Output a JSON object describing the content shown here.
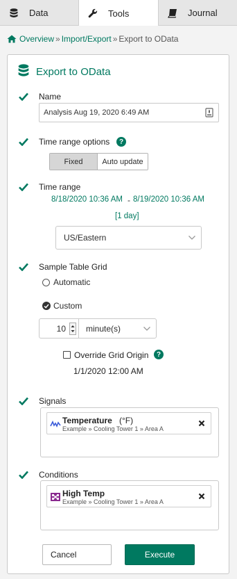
{
  "tabs": [
    {
      "label": "Data",
      "icon": "database-icon"
    },
    {
      "label": "Tools",
      "icon": "wrench-icon"
    },
    {
      "label": "Journal",
      "icon": "book-icon"
    }
  ],
  "breadcrumb": {
    "home": "Overview",
    "sep": "»",
    "import_export": "Import/Export",
    "current": "Export to OData"
  },
  "panel_title": "Export to OData",
  "name": {
    "label": "Name",
    "value": "Analysis Aug 19, 2020 6:49 AM"
  },
  "time_range_options": {
    "label": "Time range options",
    "help": "?",
    "fixed": "Fixed",
    "auto_update": "Auto update"
  },
  "time_range": {
    "label": "Time range",
    "start": "8/18/2020 10:36 AM",
    "sep": "-",
    "end": "8/19/2020 10:36 AM",
    "duration": "[1 day]",
    "timezone": "US/Eastern"
  },
  "grid": {
    "label": "Sample Table Grid",
    "automatic": "Automatic",
    "custom": "Custom",
    "quantity": "10",
    "unit": "minute(s)",
    "override_label": "Override Grid Origin",
    "help": "?",
    "origin": "1/1/2020 12:00 AM"
  },
  "signals": {
    "label": "Signals",
    "items": [
      {
        "name": "Temperature",
        "unit": "(°F)",
        "path": "Example » Cooling Tower 1 » Area A"
      }
    ]
  },
  "conditions": {
    "label": "Conditions",
    "items": [
      {
        "name": "High Temp",
        "path": "Example » Cooling Tower 1 » Area A"
      }
    ]
  },
  "buttons": {
    "cancel": "Cancel",
    "execute": "Execute"
  },
  "colors": {
    "accent": "#007960",
    "condition_icon": "#8a2a8f"
  }
}
